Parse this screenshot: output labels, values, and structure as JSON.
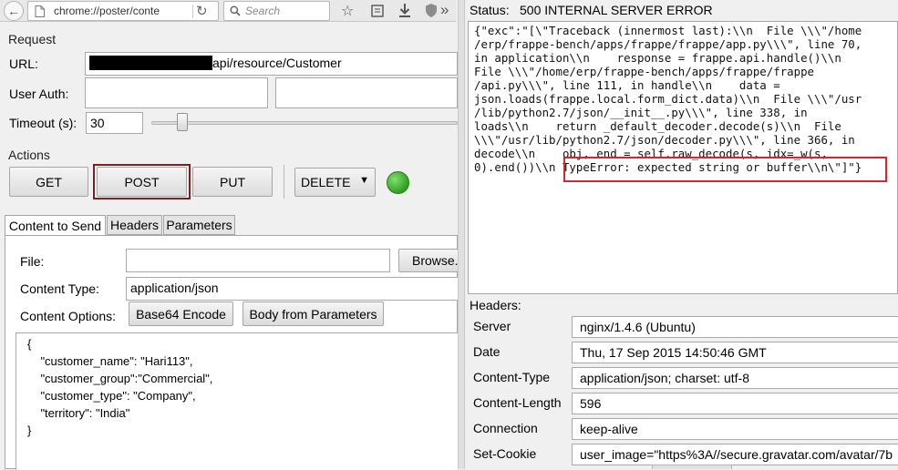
{
  "browser": {
    "url": "chrome://poster/conte",
    "search_placeholder": "Search"
  },
  "request": {
    "section_label": "Request",
    "url_label": "URL:",
    "url_value": "api/resource/Customer",
    "auth_label": "User Auth:",
    "auth_user": "",
    "auth_password": "",
    "timeout_label": "Timeout (s):",
    "timeout_value": "30"
  },
  "actions": {
    "section_label": "Actions",
    "get": "GET",
    "post": "POST",
    "put": "PUT",
    "method_select": "DELETE",
    "status_light_color": "#35a82a"
  },
  "tabs": [
    "Content to Send",
    "Headers",
    "Parameters"
  ],
  "content": {
    "file_label": "File:",
    "file_value": "",
    "browse_button": "Browse...",
    "content_type_label": "Content Type:",
    "content_type_value": "application/json",
    "content_options_label": "Content Options:",
    "base64_button": "Base64 Encode",
    "body_params_button": "Body from Parameters",
    "body_lines": [
      "{",
      "    \"customer_name\": \"Hari113\",",
      "    \"customer_group\":\"Commercial\",",
      "    \"customer_type\": \"Company\",",
      "    \"territory\": \"India\"",
      "}"
    ]
  },
  "response": {
    "status_label": "Status:",
    "status_value": "500 INTERNAL SERVER ERROR",
    "body_lines": [
      "{\"exc\":\"[\\\"Traceback (innermost last):\\\\n  File \\\\\\\"/home",
      "/erp/frappe-bench/apps/frappe/frappe/app.py\\\\\\\", line 70,",
      "in application\\\\n    response = frappe.api.handle()\\\\n",
      "File \\\\\\\"/home/erp/frappe-bench/apps/frappe/frappe",
      "/api.py\\\\\\\", line 111, in handle\\\\n    data =",
      "json.loads(frappe.local.form_dict.data)\\\\n  File \\\\\\\"/usr",
      "/lib/python2.7/json/__init__.py\\\\\\\", line 338, in",
      "loads\\\\n    return _default_decoder.decode(s)\\\\n  File",
      "\\\\\\\"/usr/lib/python2.7/json/decoder.py\\\\\\\", line 366, in",
      "decode\\\\n    obj, end = self.raw_decode(s, idx=_w(s,",
      "0).end())\\\\n TypeError: expected string or buffer\\\\n\\\"]\"}"
    ],
    "highlight_color": "#d0282c",
    "headers_label": "Headers:",
    "headers": [
      {
        "name": "Server",
        "value": "nginx/1.4.6 (Ubuntu)"
      },
      {
        "name": "Date",
        "value": "Thu, 17 Sep 2015 14:50:46 GMT"
      },
      {
        "name": "Content-Type",
        "value": "application/json; charset: utf-8"
      },
      {
        "name": "Content-Length",
        "value": "596"
      },
      {
        "name": "Connection",
        "value": "keep-alive"
      },
      {
        "name": "Set-Cookie",
        "value": "user_image=\"https%3A//secure.gravatar.com/avatar/7b"
      }
    ]
  }
}
